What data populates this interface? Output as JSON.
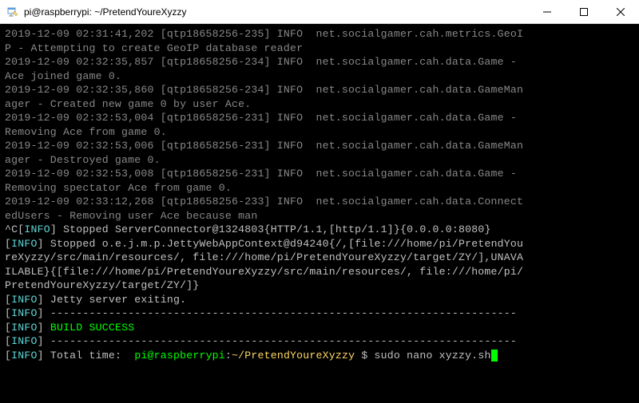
{
  "window": {
    "title": "pi@raspberrypi: ~/PretendYoureXyzzy"
  },
  "log": {
    "l1a": "2019-12-09 02:31:41,202 [qtp18658256-235] INFO  net.socialgamer.cah.metrics.GeoI",
    "l1b": "P - Attempting to create GeoIP database reader",
    "l2a": "2019-12-09 02:32:35,857 [qtp18658256-234] INFO  net.socialgamer.cah.data.Game - ",
    "l2b": "Ace joined game 0.",
    "l3a": "2019-12-09 02:32:35,860 [qtp18658256-234] INFO  net.socialgamer.cah.data.GameMan",
    "l3b": "ager - Created new game 0 by user Ace.",
    "l4a": "2019-12-09 02:32:53,004 [qtp18658256-231] INFO  net.socialgamer.cah.data.Game - ",
    "l4b": "Removing Ace from game 0.",
    "l5a": "2019-12-09 02:32:53,006 [qtp18658256-231] INFO  net.socialgamer.cah.data.GameMan",
    "l5b": "ager - Destroyed game 0.",
    "l6a": "2019-12-09 02:32:53,008 [qtp18658256-231] INFO  net.socialgamer.cah.data.Game - ",
    "l6b": "Removing spectator Ace from game 0.",
    "l7a": "2019-12-09 02:33:12,268 [qtp18658256-233] INFO  net.socialgamer.cah.data.Connect",
    "l7b": "edUsers - Removing user Ace because man",
    "intr": "^C",
    "info_label": "INFO",
    "br_l": "[",
    "br_r": "]",
    "sep": " ------------------------------------------------------------------------",
    "stop1": " Stopped ServerConnector@1324803{HTTP/1.1,[http/1.1]}{0.0.0.0:8080}",
    "stop2a": " Stopped o.e.j.m.p.JettyWebAppContext@d94240{/,[file:///home/pi/PretendYou",
    "stop2b": "reXyzzy/src/main/resources/, file:///home/pi/PretendYoureXyzzy/target/ZY/],UNAVA",
    "stop2c": "ILABLE}{[file:///home/pi/PretendYoureXyzzy/src/main/resources/, file:///home/pi/",
    "stop2d": "PretendYoureXyzzy/target/ZY/]}",
    "exit": " Jetty server exiting.",
    "build": "BUILD SUCCESS",
    "total": " Total time:  ",
    "prompt_user": "pi@raspberrypi",
    "prompt_sep": ":",
    "prompt_path": "~/PretendYoureXyzzy",
    "prompt_end": " $ ",
    "cmd": "sudo nano xyzzy.sh"
  }
}
